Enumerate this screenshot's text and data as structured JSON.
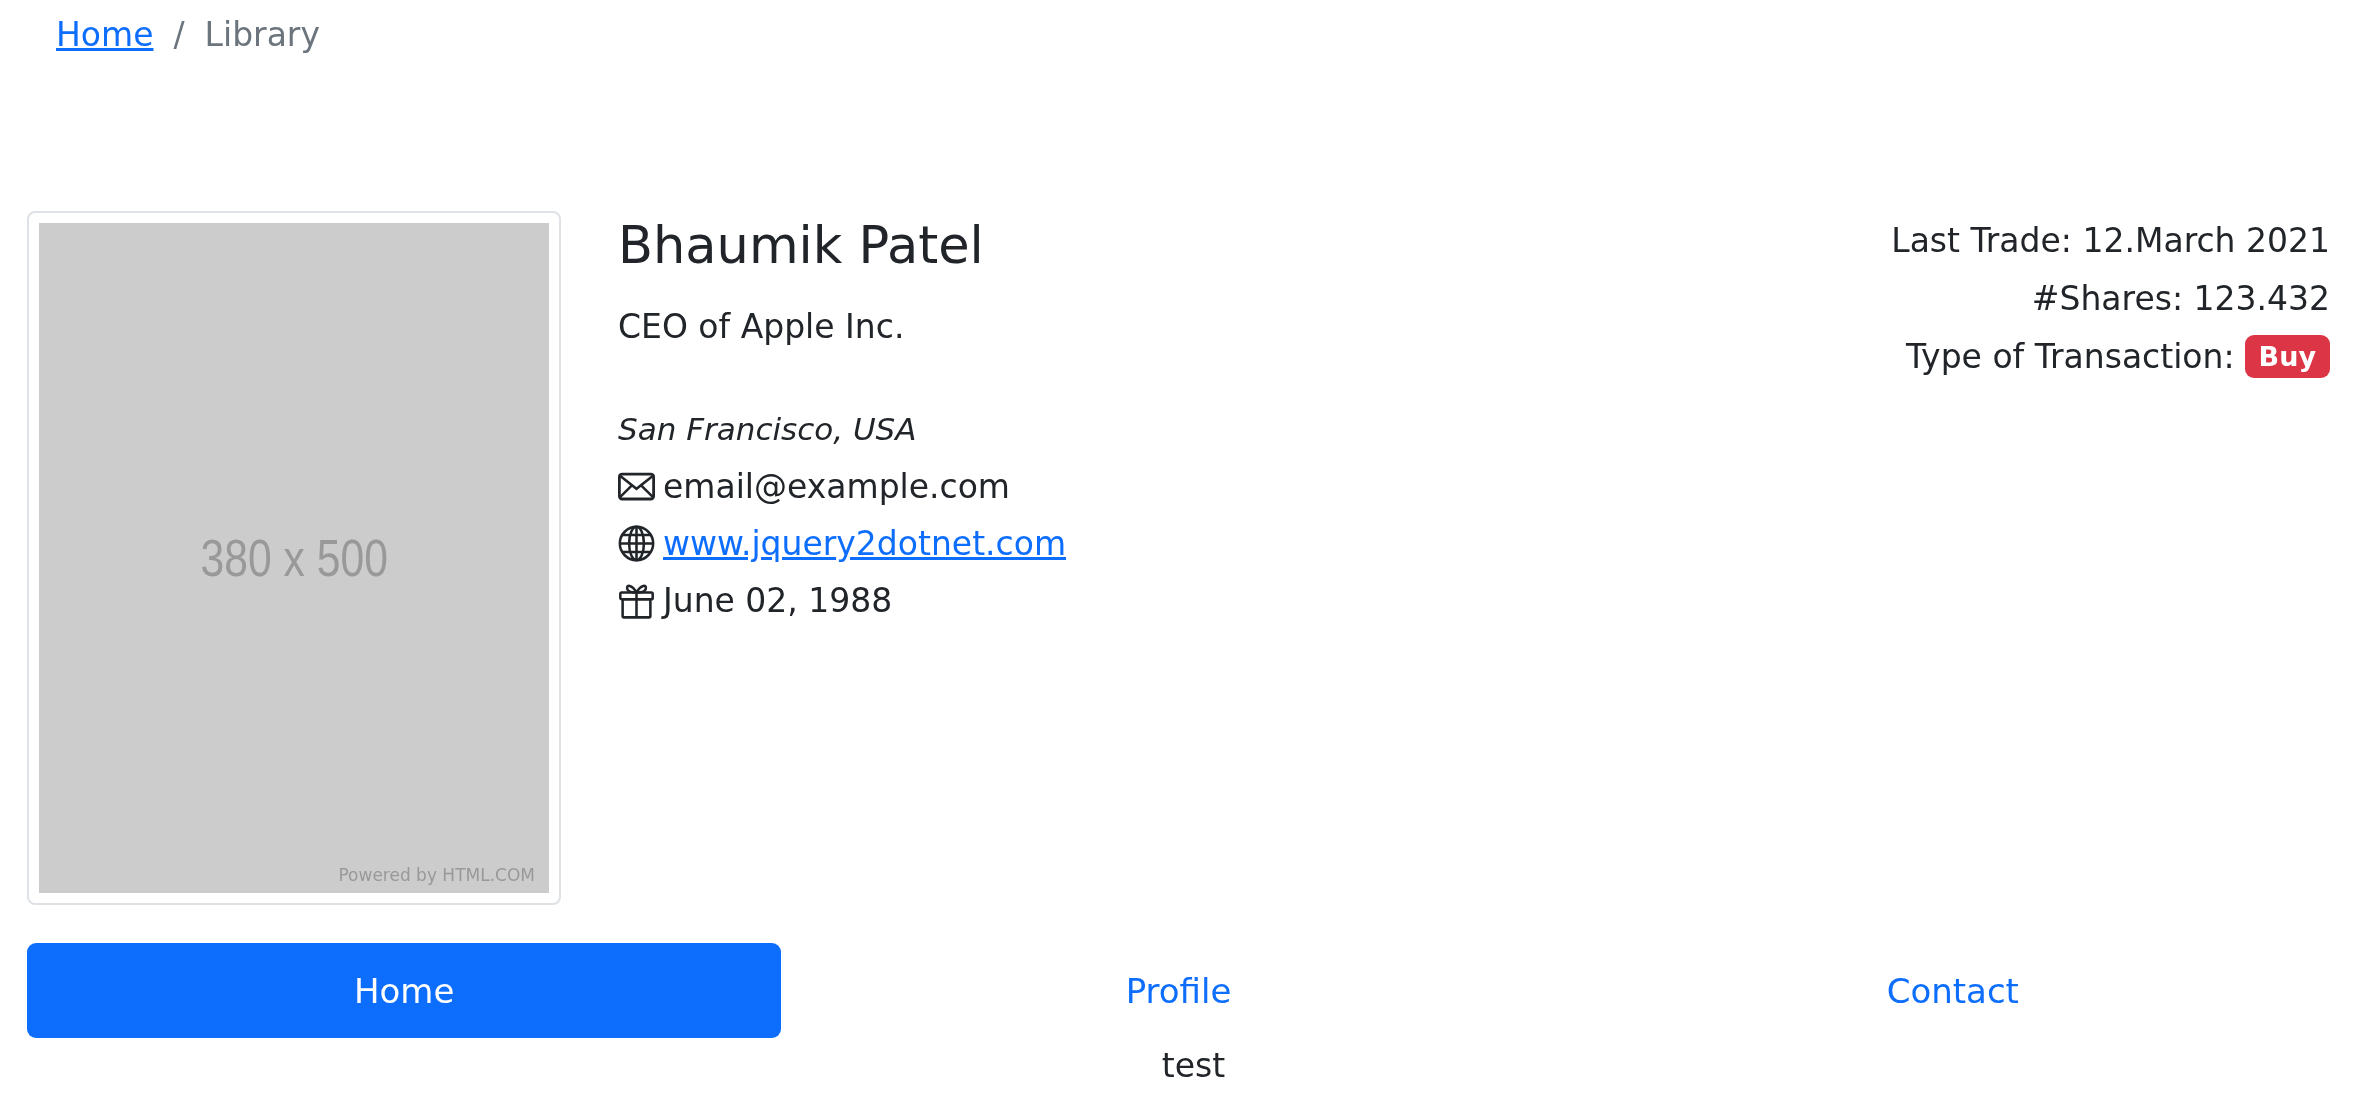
{
  "breadcrumb_separator": "/",
  "breadcrumb": [
    {
      "label": "Home",
      "kind": "link"
    },
    {
      "label": "Library",
      "kind": "current"
    }
  ],
  "profile": {
    "photo": {
      "label": "380 x 500",
      "credit": "Powered by HTML.COM"
    },
    "name": "Bhaumik Patel",
    "title": "CEO of Apple Inc.",
    "location": "San Francisco, USA",
    "contacts": [
      {
        "kind": "email",
        "text": "email@example.com"
      },
      {
        "kind": "website",
        "text": "www.jquery2dotnet.com"
      },
      {
        "kind": "birthday",
        "text": "June 02, 1988"
      }
    ]
  },
  "trade": {
    "last_trade": "Last Trade: 12.March 2021",
    "shares": "#Shares: 123.432",
    "transaction_label": "Type of Transaction:",
    "transaction_badge": "Buy"
  },
  "tabs": [
    {
      "label": "Home",
      "selected": true
    },
    {
      "label": "Profile",
      "selected": false
    },
    {
      "label": "Contact",
      "selected": false
    }
  ],
  "tab_content": "test"
}
